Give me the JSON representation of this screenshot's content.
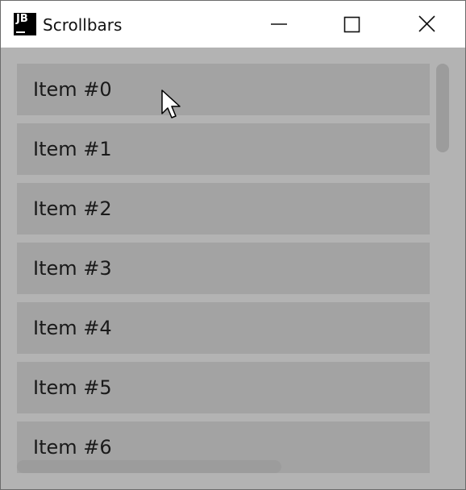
{
  "window": {
    "title": "Scrollbars",
    "app_icon_text": "JB"
  },
  "items": [
    {
      "label": "Item #0"
    },
    {
      "label": "Item #1"
    },
    {
      "label": "Item #2"
    },
    {
      "label": "Item #3"
    },
    {
      "label": "Item #4"
    },
    {
      "label": "Item #5"
    },
    {
      "label": "Item #6"
    }
  ],
  "icons": {
    "minimize": "minimize-icon",
    "maximize": "maximize-icon",
    "close": "close-icon",
    "cursor": "mouse-pointer-icon"
  },
  "colors": {
    "background": "#b3b3b3",
    "item": "#a3a3a3",
    "scrollbar_thumb": "#9c9c9c",
    "titlebar": "#ffffff"
  }
}
